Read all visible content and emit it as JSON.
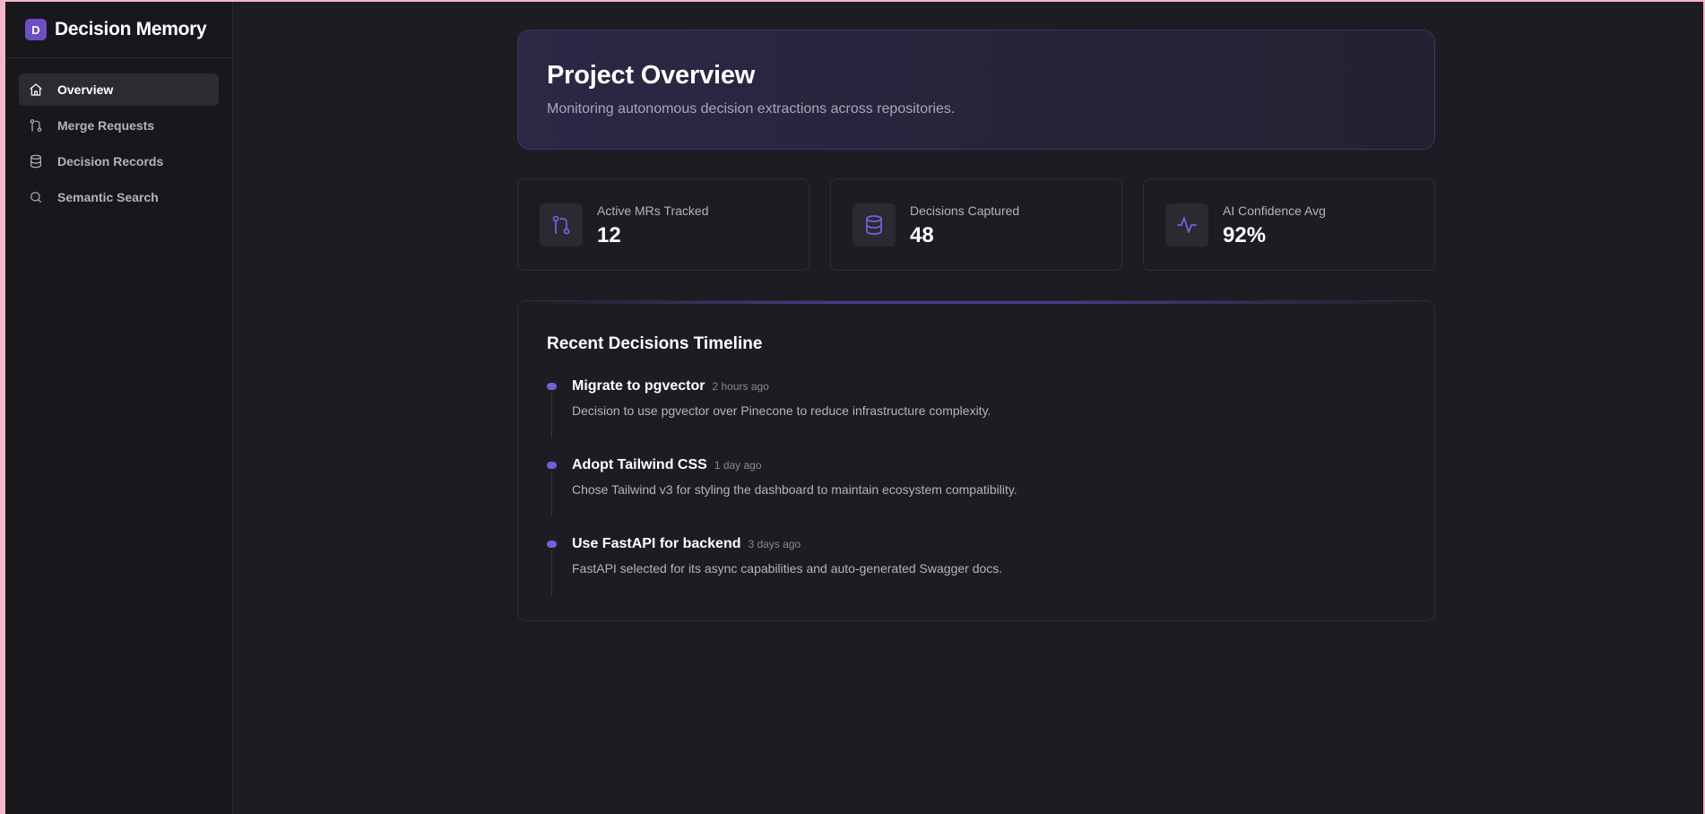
{
  "brand": {
    "logo_letter": "D",
    "name": "Decision Memory"
  },
  "sidebar": {
    "items": [
      {
        "label": "Overview",
        "icon": "home-icon",
        "active": true
      },
      {
        "label": "Merge Requests",
        "icon": "git-merge-icon",
        "active": false
      },
      {
        "label": "Decision Records",
        "icon": "database-icon",
        "active": false
      },
      {
        "label": "Semantic Search",
        "icon": "search-icon",
        "active": false
      }
    ]
  },
  "hero": {
    "title": "Project Overview",
    "subtitle": "Monitoring autonomous decision extractions across repositories."
  },
  "stats": [
    {
      "label": "Active MRs Tracked",
      "value": "12",
      "icon": "git-merge-icon"
    },
    {
      "label": "Decisions Captured",
      "value": "48",
      "icon": "database-icon"
    },
    {
      "label": "AI Confidence Avg",
      "value": "92%",
      "icon": "activity-icon"
    }
  ],
  "timeline": {
    "title": "Recent Decisions Timeline",
    "items": [
      {
        "name": "Migrate to pgvector",
        "time": "2 hours ago",
        "description": "Decision to use pgvector over Pinecone to reduce infrastructure complexity."
      },
      {
        "name": "Adopt Tailwind CSS",
        "time": "1 day ago",
        "description": "Chose Tailwind v3 for styling the dashboard to maintain ecosystem compatibility."
      },
      {
        "name": "Use FastAPI for backend",
        "time": "3 days ago",
        "description": "FastAPI selected for its async capabilities and auto-generated Swagger docs."
      }
    ]
  },
  "colors": {
    "accent": "#7b5ce0",
    "background": "#1d1c22",
    "sidebar": "#18171c",
    "frame": "#f4b6c8"
  }
}
